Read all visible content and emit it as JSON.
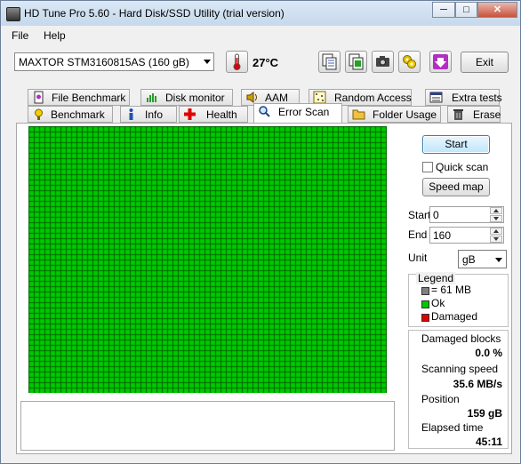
{
  "window": {
    "title": "HD Tune Pro 5.60 - Hard Disk/SSD Utility (trial version)",
    "controls": [
      "minimize",
      "maximize",
      "close"
    ]
  },
  "menu": [
    {
      "label": "File",
      "key": "F"
    },
    {
      "label": "Help",
      "key": "H"
    }
  ],
  "toolbar": {
    "drive": "MAXTOR STM3160815AS (160 gB)",
    "temperature": "27°C",
    "exit_label": "Exit",
    "icons": [
      "thermometer-icon",
      "copy-text-icon",
      "copy-screenshot-icon",
      "camera-icon",
      "options-icon",
      "save-icon"
    ]
  },
  "tabs": {
    "row1": [
      "File Benchmark",
      "Disk monitor",
      "AAM",
      "Random Access",
      "Extra tests"
    ],
    "row2": [
      "Benchmark",
      "Info",
      "Health",
      "Error Scan",
      "Folder Usage",
      "Erase"
    ],
    "active": "Error Scan"
  },
  "scan": {
    "start_button": "Start",
    "quick_scan_label": "Quick scan",
    "quick_scan_checked": false,
    "speed_map_button": "Speed map",
    "start_label": "Start",
    "start_value": "0",
    "end_label": "End",
    "end_value": "160",
    "unit_label": "Unit",
    "unit_value": "gB",
    "grid": {
      "ok_fraction": 1.0,
      "color_ok": "#00c800",
      "color_line": "#006400"
    }
  },
  "legend": {
    "title": "Legend",
    "block_size": "= 61 MB",
    "ok": "Ok",
    "damaged": "Damaged",
    "color_block": "#808080",
    "color_ok": "#00c800",
    "color_damaged": "#e00000"
  },
  "stats": {
    "damaged_blocks_label": "Damaged blocks",
    "damaged_blocks_value": "0.0 %",
    "scanning_speed_label": "Scanning speed",
    "scanning_speed_value": "35.6 MB/s",
    "position_label": "Position",
    "position_value": "159 gB",
    "elapsed_label": "Elapsed time",
    "elapsed_value": "45:11"
  }
}
